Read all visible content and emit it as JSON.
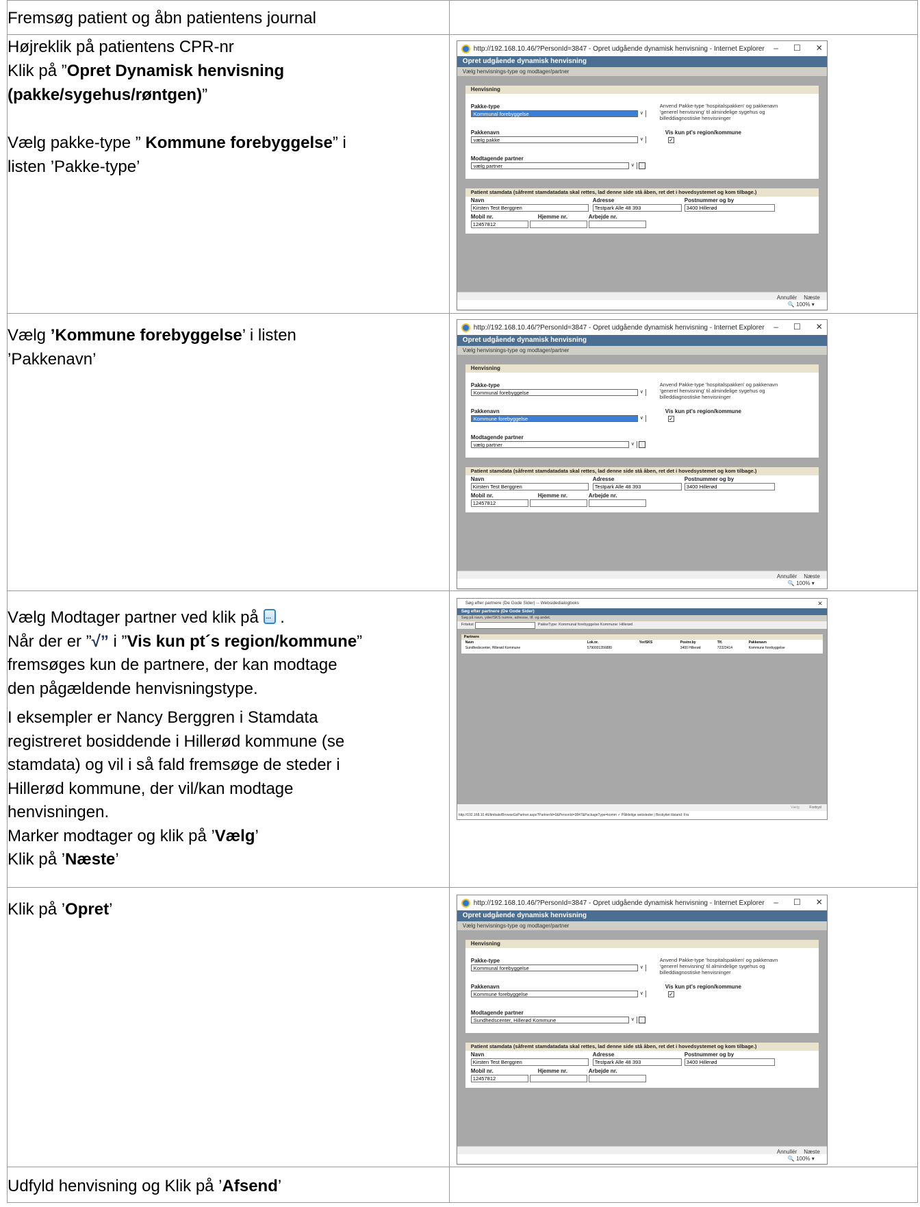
{
  "rows": [
    {
      "text": "Fremsøg patient og åbn patientens journal"
    },
    {
      "lines": [
        "Højreklik på patientens CPR-nr",
        "Klik på ”",
        "Opret Dynamisk henvisning",
        "(pakke/sygehus/røntgen)",
        "”",
        "Vælg pakke-type ” ",
        "Kommune forebyggelse",
        "” i",
        "listen ’Pakke-type’"
      ]
    },
    {
      "lines": [
        "Vælg ",
        "’Kommune forebyggelse",
        "’ i listen",
        "’Pakkenavn’"
      ]
    },
    {
      "lines": [
        "Vælg Modtager partner ved klik på ",
        " .",
        "Når der er ”",
        "√”",
        " i ”",
        "Vis kun pt´s region/kommune",
        "”",
        "fremsøges kun de partnere, der kan modtage",
        "den pågældende henvisningstype.",
        "I eksempler er Nancy Berggren i Stamdata",
        "registreret bosiddende i Hillerød kommune (se",
        "stamdata) og vil i så fald fremsøge de steder i",
        "Hillerød kommune, der vil/kan modtage",
        "henvisningen.",
        "Marker modtager og klik på ’",
        "Vælg",
        "’",
        "Klik på ’",
        "Næste",
        "’"
      ]
    },
    {
      "lines": [
        "Klik på ’",
        "Opret",
        "’"
      ]
    },
    {
      "lines": [
        "Udfyld henvisning og Klik på ’",
        "Afsend",
        "’"
      ]
    }
  ],
  "ie": {
    "title": "http://192.168.10.46/?PersonId=3847 - Opret udgående dynamisk henvisning - Internet Explorer",
    "win_buttons": [
      "–",
      "☐",
      "✕"
    ],
    "header": "Opret udgående dynamisk henvisning",
    "subheader": "Vælg henvisnings-type og modtager/partner",
    "panel_title": "Henvisning",
    "pakke_type_label": "Pakke-type",
    "pakke_type_value": "Kommunal forebyggelse",
    "note": "Anvend Pakke-type 'hospitalspakken' og pakkenavn 'generel henvisning' til almindelige sygehus og billeddiagnostiske henvisninger",
    "pakkenavn_label": "Pakkenavn",
    "pakkenavn_default": "vælg pakke",
    "pakkenavn_selected": "Kommune forebyggelse",
    "vis_kun_label": "Vis kun pt's region/kommune",
    "check": "✓",
    "partner_label": "Modtagende partner",
    "partner_default": "vælg partner",
    "partner_selected": "Sundhedscenter, Hillerød Kommune",
    "stamdata_title": "Patient stamdata (såfremt stamdatadata skal rettes, lad denne side stå åben, ret det i hovedsystemet og kom tilbage.)",
    "navn_label": "Navn",
    "navn_value": "Kirsten Test Berggren",
    "adresse_label": "Adresse",
    "adresse_value": "Testpark Alle 48 393",
    "postnr_label": "Postnummer og by",
    "postnr_value": "3400  Hillerød",
    "mobil_label": "Mobil nr.",
    "mobil_value": "12457812",
    "hjemme_label": "Hjemme nr.",
    "arbejde_label": "Arbejde nr.",
    "annuller": "Annullér",
    "naeste": "Næste",
    "zoom": "100%"
  },
  "dlg": {
    "title": "Søg efter partnere (De Gode Sider) -- Websidedialogboks",
    "header": "Søg efter partnere (De Gode Sider)",
    "subheader": "Søg på navn, yder/SKS numre, adresse, tlf. og andet.",
    "fritekst_label": "Fritekst",
    "filter_text": "PakkeType: Kommunal forebyggelse  Kommune: Hillerød",
    "table_title": "Partnere",
    "columns": [
      "Navn",
      "Lok.nr.",
      "Yer/SKS",
      "Postnr.by",
      "Tlf.",
      "Pakkenavn"
    ],
    "row": [
      "Sundhedscenter, Hillerød Kommune",
      "5790001356880",
      "",
      "3400 Hillerød",
      "72323414",
      "Kommune forebyggelse"
    ],
    "foot_buttons": [
      "Vælg",
      "Fortryd"
    ],
    "status": "http://192.168.10.46/timbale/BrowseGsPartner.aspx?PartnerId=0&PersonId=3847&PackageType=komm  ✓ Pålidelige websteder | Beskyttet tilstand: Fra"
  }
}
